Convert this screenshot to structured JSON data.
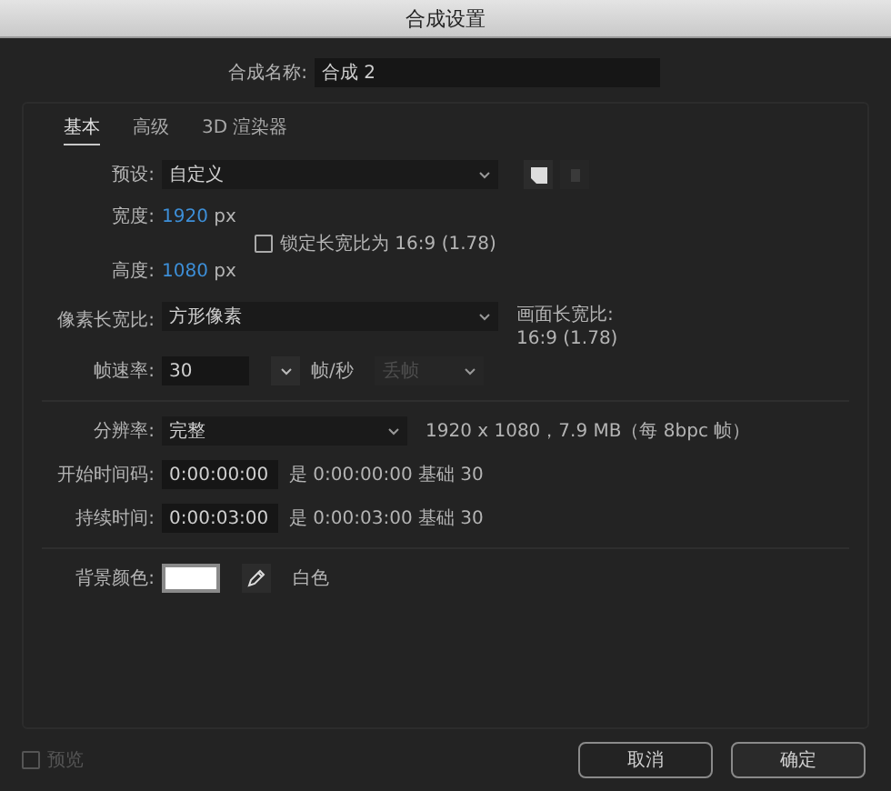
{
  "window": {
    "title": "合成设置"
  },
  "comp_name": {
    "label": "合成名称:",
    "value": "合成 2"
  },
  "tabs": [
    {
      "label": "基本",
      "selected": true
    },
    {
      "label": "高级",
      "selected": false
    },
    {
      "label": "3D 渲染器",
      "selected": false
    }
  ],
  "preset": {
    "label": "预设:",
    "value": "自定义"
  },
  "width": {
    "label": "宽度:",
    "value": "1920",
    "unit": "px"
  },
  "height": {
    "label": "高度:",
    "value": "1080",
    "unit": "px"
  },
  "lock_aspect": {
    "label": "锁定长宽比为 16:9 (1.78)",
    "checked": false
  },
  "pixel_aspect": {
    "label": "像素长宽比:",
    "value": "方形像素"
  },
  "frame_aspect": {
    "label": "画面长宽比:",
    "value": "16:9 (1.78)"
  },
  "frame_rate": {
    "label": "帧速率:",
    "value": "30",
    "unit": "帧/秒",
    "drop_frame": {
      "value": "丢帧",
      "disabled": true
    }
  },
  "resolution": {
    "label": "分辨率:",
    "value": "完整",
    "info": "1920 x 1080，7.9 MB（每 8bpc 帧）"
  },
  "start_timecode": {
    "label": "开始时间码:",
    "value": "0:00:00:00",
    "info": "是 0:00:00:00 基础 30"
  },
  "duration": {
    "label": "持续时间:",
    "value": "0:00:03:00",
    "info": "是 0:00:03:00 基础 30"
  },
  "background": {
    "label": "背景颜色:",
    "color": "#ffffff",
    "name": "白色"
  },
  "preview": {
    "label": "预览",
    "checked": false,
    "disabled": true
  },
  "buttons": [
    {
      "label": "取消",
      "kind": "cancel"
    },
    {
      "label": "确定",
      "kind": "ok"
    }
  ]
}
